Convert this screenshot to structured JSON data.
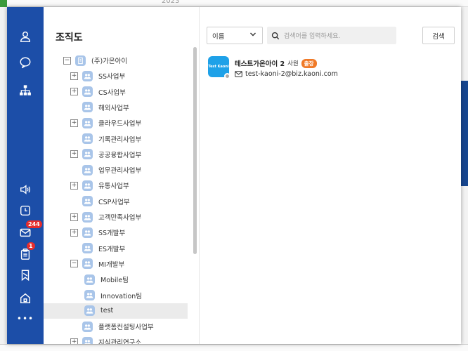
{
  "background": {
    "year_text": "2023"
  },
  "window": {
    "minimize": "–",
    "maximize": "□",
    "close": "×"
  },
  "rail": {
    "mail_badge": "244",
    "approval_badge": "1",
    "more": "•••"
  },
  "panel": {
    "title": "조직도"
  },
  "tree": [
    {
      "label": "(주)가온아이",
      "expander": "−",
      "icon": "building-icon"
    },
    {
      "label": "SS사업부",
      "expander": "+"
    },
    {
      "label": "CS사업부",
      "expander": "+"
    },
    {
      "label": "해외사업부",
      "expander": ""
    },
    {
      "label": "클라우드사업부",
      "expander": "+"
    },
    {
      "label": "기록관리사업부",
      "expander": ""
    },
    {
      "label": "공공융합사업부",
      "expander": "+"
    },
    {
      "label": "업무관리사업부",
      "expander": ""
    },
    {
      "label": "유통사업부",
      "expander": "+"
    },
    {
      "label": "CSP사업부",
      "expander": ""
    },
    {
      "label": "고객만족사업부",
      "expander": "+"
    },
    {
      "label": "SS개발부",
      "expander": "+"
    },
    {
      "label": "ES개발부",
      "expander": ""
    },
    {
      "label": "MI개발부",
      "expander": "−"
    },
    {
      "label": "Mobile팀",
      "expander": ""
    },
    {
      "label": "Innovation팀",
      "expander": ""
    },
    {
      "label": "test",
      "expander": "",
      "selected": true
    },
    {
      "label": "플랫폼컨설팅사업부",
      "expander": ""
    },
    {
      "label": "지식관리연구소",
      "expander": "+"
    }
  ],
  "search": {
    "field_select": "이름",
    "placeholder": "검색어를 입력하세요.",
    "button": "검색"
  },
  "member": {
    "avatar_text": "Test Kaoni",
    "name": "테스트가온아이 2",
    "role": "사원",
    "badge": "출장",
    "email": "test-kaoni-2@biz.kaoni.com"
  },
  "colors": {
    "rail": "#1c4ea8",
    "badge_red": "#e62d2d",
    "status_orange": "#f07a28",
    "avatar_blue": "#1ea1e8",
    "group_icon": "#a9c5e9"
  }
}
